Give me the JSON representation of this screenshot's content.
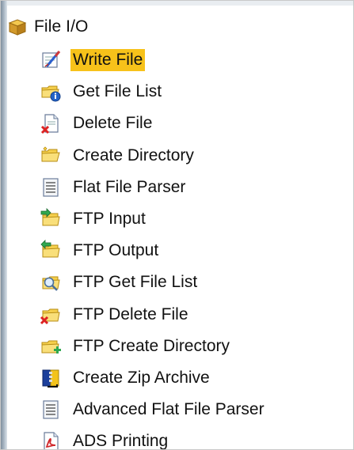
{
  "tree": {
    "root": {
      "label": "File I/O",
      "icon": "package-icon"
    },
    "items": [
      {
        "label": "Write File",
        "icon": "write-file-icon",
        "selected": true
      },
      {
        "label": "Get File List",
        "icon": "folder-info-icon",
        "selected": false
      },
      {
        "label": "Delete File",
        "icon": "delete-file-icon",
        "selected": false
      },
      {
        "label": "Create Directory",
        "icon": "folder-icon",
        "selected": false
      },
      {
        "label": "Flat File Parser",
        "icon": "document-lines-icon",
        "selected": false
      },
      {
        "label": "FTP Input",
        "icon": "ftp-input-icon",
        "selected": false
      },
      {
        "label": "FTP Output",
        "icon": "ftp-output-icon",
        "selected": false
      },
      {
        "label": "FTP Get File List",
        "icon": "ftp-search-icon",
        "selected": false
      },
      {
        "label": "FTP Delete File",
        "icon": "ftp-delete-icon",
        "selected": false
      },
      {
        "label": "FTP Create Directory",
        "icon": "ftp-create-directory-icon",
        "selected": false
      },
      {
        "label": "Create Zip Archive",
        "icon": "zip-archive-icon",
        "selected": false
      },
      {
        "label": "Advanced Flat File Parser",
        "icon": "document-lines-icon",
        "selected": false
      },
      {
        "label": "ADS Printing",
        "icon": "pdf-print-icon",
        "selected": false
      }
    ]
  },
  "colors": {
    "selection": "#f7c21a",
    "rail": "#8a9aaa"
  }
}
